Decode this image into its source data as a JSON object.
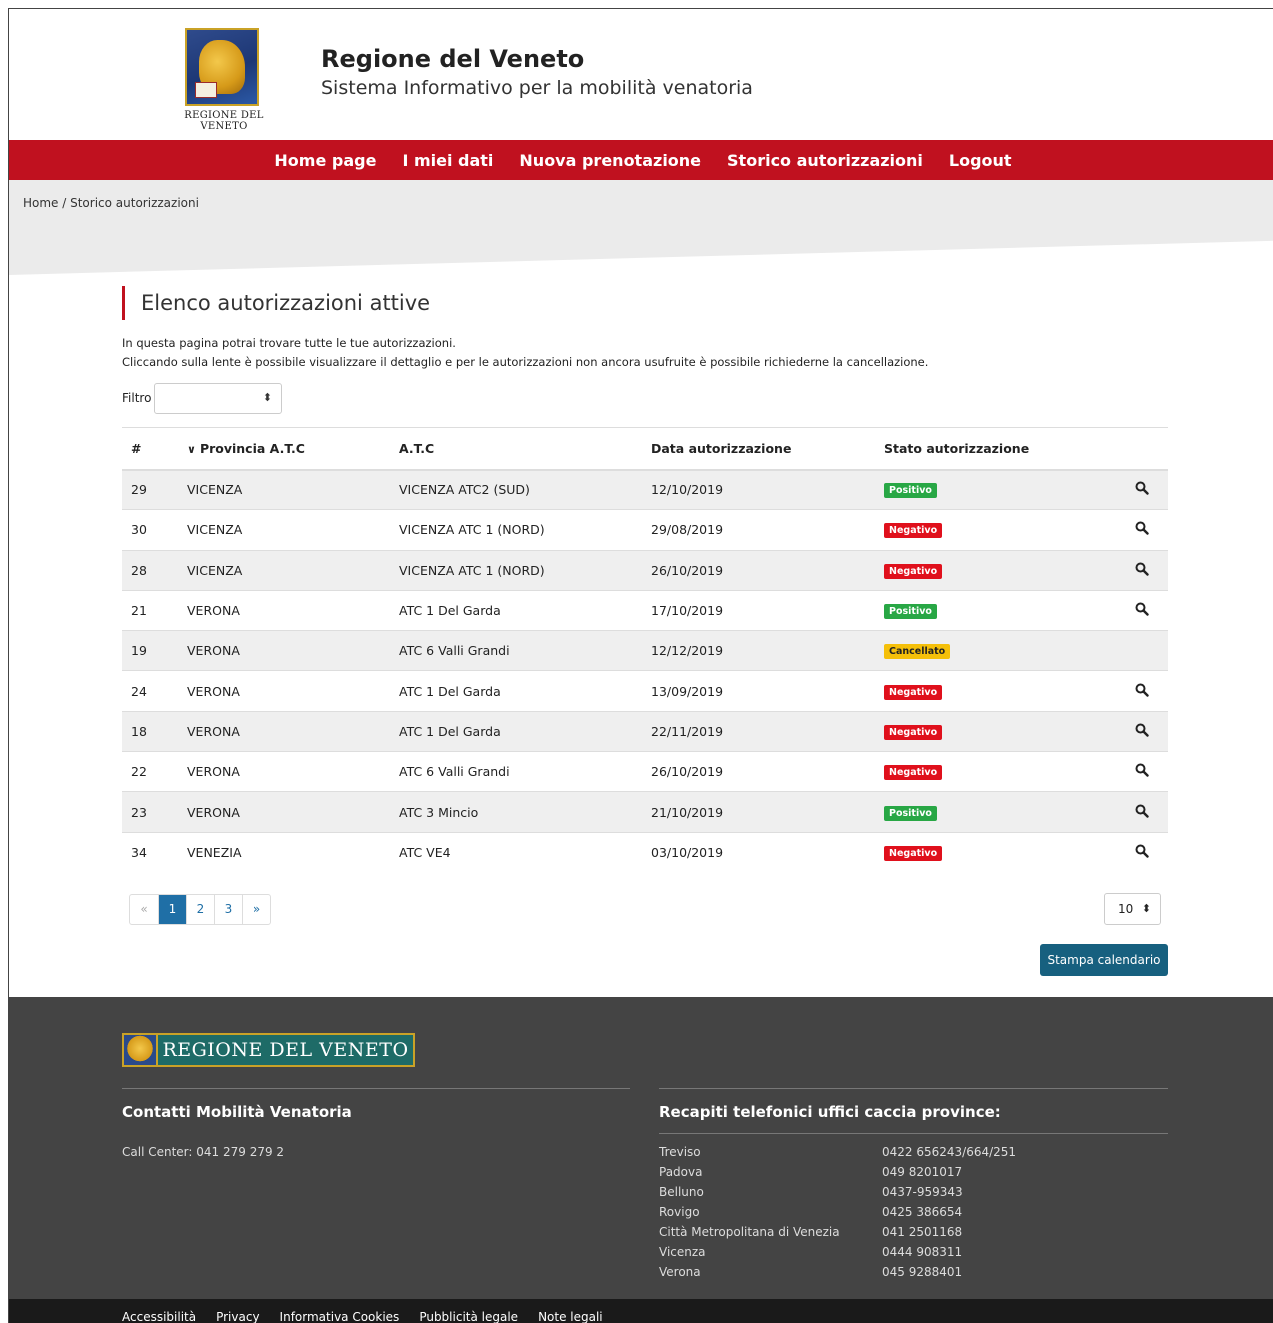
{
  "header": {
    "crest_caption": "REGIONE DEL VENETO",
    "title": "Regione del Veneto",
    "subtitle": "Sistema Informativo per la mobilità venatoria"
  },
  "nav": {
    "items": [
      "Home page",
      "I miei dati",
      "Nuova prenotazione",
      "Storico autorizzazioni",
      "Logout"
    ]
  },
  "breadcrumb": {
    "home": "Home",
    "separator": " / ",
    "current": "Storico autorizzazioni"
  },
  "main": {
    "title": "Elenco autorizzazioni attive",
    "intro_line1": "In questa pagina potrai trovare tutte le tue autorizzazioni.",
    "intro_line2": "Cliccando sulla lente è possibile visualizzare il dettaglio e per le autorizzazioni non ancora usufruite è possibile richiederne la cancellazione.",
    "filter_label": "Filtro",
    "filter_value": ""
  },
  "table": {
    "headers": {
      "num": "#",
      "province": "Provincia A.T.C",
      "atc": "A.T.C",
      "date": "Data autorizzazione",
      "status": "Stato autorizzazione"
    },
    "rows": [
      {
        "num": "29",
        "province": "VICENZA",
        "atc": "VICENZA ATC2 (SUD)",
        "date": "12/10/2019",
        "status": "Positivo",
        "kind": "pos",
        "detail": true
      },
      {
        "num": "30",
        "province": "VICENZA",
        "atc": "VICENZA ATC 1 (NORD)",
        "date": "29/08/2019",
        "status": "Negativo",
        "kind": "neg",
        "detail": true
      },
      {
        "num": "28",
        "province": "VICENZA",
        "atc": "VICENZA ATC 1 (NORD)",
        "date": "26/10/2019",
        "status": "Negativo",
        "kind": "neg",
        "detail": true
      },
      {
        "num": "21",
        "province": "VERONA",
        "atc": "ATC 1 Del Garda",
        "date": "17/10/2019",
        "status": "Positivo",
        "kind": "pos",
        "detail": true
      },
      {
        "num": "19",
        "province": "VERONA",
        "atc": "ATC 6 Valli Grandi",
        "date": "12/12/2019",
        "status": "Cancellato",
        "kind": "can",
        "detail": false
      },
      {
        "num": "24",
        "province": "VERONA",
        "atc": "ATC 1 Del Garda",
        "date": "13/09/2019",
        "status": "Negativo",
        "kind": "neg",
        "detail": true
      },
      {
        "num": "18",
        "province": "VERONA",
        "atc": "ATC 1 Del Garda",
        "date": "22/11/2019",
        "status": "Negativo",
        "kind": "neg",
        "detail": true
      },
      {
        "num": "22",
        "province": "VERONA",
        "atc": "ATC 6 Valli Grandi",
        "date": "26/10/2019",
        "status": "Negativo",
        "kind": "neg",
        "detail": true
      },
      {
        "num": "23",
        "province": "VERONA",
        "atc": "ATC 3 Mincio",
        "date": "21/10/2019",
        "status": "Positivo",
        "kind": "pos",
        "detail": true
      },
      {
        "num": "34",
        "province": "VENEZIA",
        "atc": "ATC VE4",
        "date": "03/10/2019",
        "status": "Negativo",
        "kind": "neg",
        "detail": true
      }
    ]
  },
  "pagination": {
    "prev": "«",
    "pages": [
      "1",
      "2",
      "3"
    ],
    "active_page": "1",
    "next": "»",
    "page_size": "10"
  },
  "print_button": "Stampa calendario",
  "footer": {
    "logo_text": "REGIONE DEL VENETO",
    "contacts_title": "Contatti Mobilità Venatoria",
    "call_center": "Call Center: 041 279 279 2",
    "offices_title": "Recapiti telefonici uffici caccia province:",
    "offices": [
      {
        "city": "Treviso",
        "phone": "0422 656243/664/251"
      },
      {
        "city": "Padova",
        "phone": "049 8201017"
      },
      {
        "city": "Belluno",
        "phone": "0437-959343"
      },
      {
        "city": "Rovigo",
        "phone": "0425 386654"
      },
      {
        "city": "Città Metropolitana di Venezia",
        "phone": "041 2501168"
      },
      {
        "city": "Vicenza",
        "phone": "0444 908311"
      },
      {
        "city": "Verona",
        "phone": "045 9288401"
      }
    ],
    "bottom_links": [
      "Accessibilità",
      "Privacy",
      "Informativa Cookies",
      "Pubblicità legale",
      "Note legali"
    ]
  },
  "colors": {
    "brand_red": "#c0111f",
    "positive": "#28a745",
    "negative": "#e0101c",
    "cancelled": "#f5c00a",
    "primary_button": "#17607f"
  }
}
